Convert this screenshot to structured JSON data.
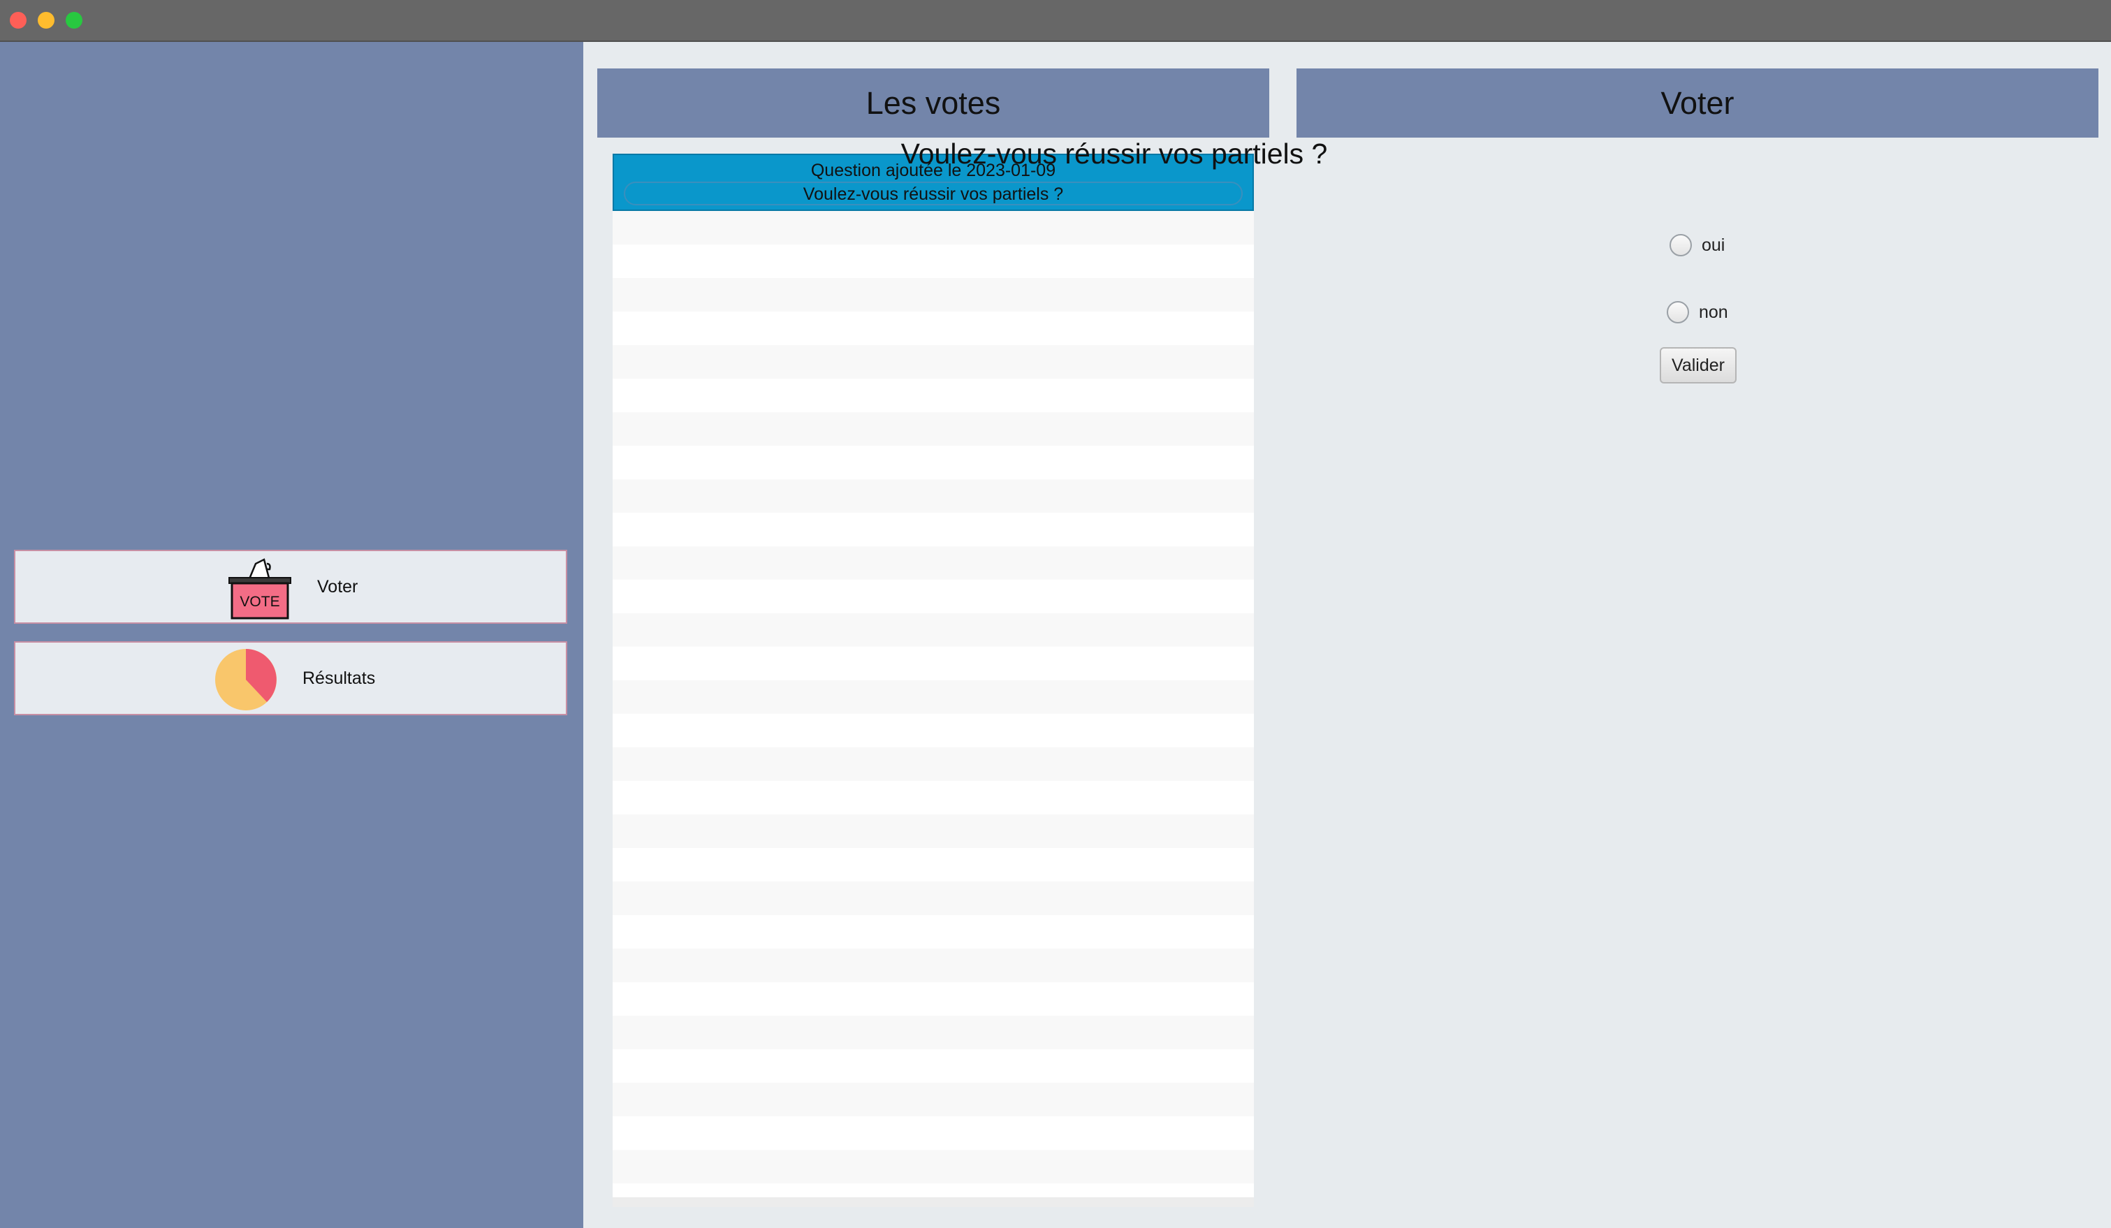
{
  "sidebar": {
    "items": [
      {
        "label": "Voter",
        "icon": "ballot-box-icon"
      },
      {
        "label": "Résultats",
        "icon": "pie-chart-icon"
      }
    ],
    "icon_text": "VOTE"
  },
  "votes_panel": {
    "title": "Les votes",
    "items": [
      {
        "date_line": "Question ajoutée le 2023-01-09",
        "question": "Voulez-vous réussir vos partiels ?",
        "selected": true
      }
    ]
  },
  "voter_panel": {
    "title": "Voter",
    "question": "Voulez-vous réussir vos partiels ?",
    "options": [
      {
        "label": "oui",
        "checked": false
      },
      {
        "label": "non",
        "checked": false
      }
    ],
    "submit_label": "Valider"
  },
  "colors": {
    "sidebar_bg": "#7385aa",
    "header_bg": "#7385aa",
    "selected_item": "#0a97cb",
    "content_bg": "#e7ebee"
  }
}
